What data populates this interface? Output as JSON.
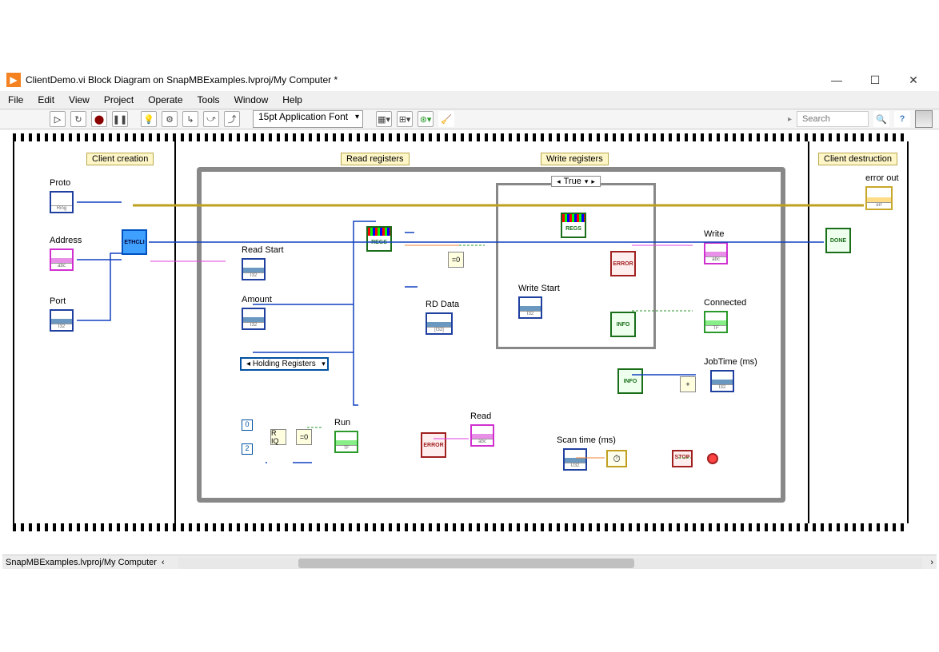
{
  "window": {
    "title": "ClientDemo.vi Block Diagram on SnapMBExamples.lvproj/My Computer *",
    "controls": {
      "minimize": "—",
      "maximize": "☐",
      "close": "✕"
    }
  },
  "menu": {
    "items": [
      "File",
      "Edit",
      "View",
      "Project",
      "Operate",
      "Tools",
      "Window",
      "Help"
    ]
  },
  "toolbar": {
    "font": "15pt Application Font",
    "search_placeholder": "Search"
  },
  "sections": {
    "client_creation": "Client creation",
    "read_registers": "Read registers",
    "write_registers": "Write registers",
    "client_destruction": "Client destruction"
  },
  "case": {
    "value": "True"
  },
  "controls": {
    "proto": "Proto",
    "address": "Address",
    "port": "Port",
    "read_start": "Read Start",
    "amount": "Amount",
    "write_start": "Write Start",
    "holding_registers": "Holding Registers",
    "scan_time": "Scan time (ms)"
  },
  "indicators": {
    "error_out": "error out",
    "rd_data": "RD Data",
    "write": "Write",
    "connected": "Connected",
    "jobtime": "JobTime (ms)",
    "read": "Read",
    "run": "Run"
  },
  "subvis": {
    "ethcli": "ETHCLI",
    "regs": "REGS",
    "error": "ERROR",
    "info": "INFO",
    "done": "DONE"
  },
  "constants": {
    "c0": "0",
    "c2": "2",
    "eq0": "=0",
    "r_iq": "R IQ",
    "plus": "+",
    "stop": "STOP"
  },
  "status": {
    "path": "SnapMBExamples.lvproj/My Computer"
  }
}
